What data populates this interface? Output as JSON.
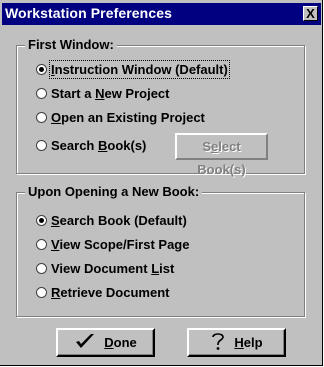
{
  "window": {
    "title": "Workstation Preferences",
    "close_glyph": "X"
  },
  "first_window": {
    "label": "First Window:",
    "options": [
      {
        "pre": "",
        "key": "I",
        "post": "nstruction Window (Default)",
        "selected": true
      },
      {
        "pre": "Start a ",
        "key": "N",
        "post": "ew Project",
        "selected": false
      },
      {
        "pre": "",
        "key": "O",
        "post": "pen an Existing Project",
        "selected": false
      },
      {
        "pre": "Search ",
        "key": "B",
        "post": "ook(s)",
        "selected": false
      }
    ],
    "select_books": {
      "pre": "S",
      "key": "e",
      "post": "lect Book(s)",
      "enabled": false
    }
  },
  "opening_book": {
    "label": "Upon Opening a New Book:",
    "options": [
      {
        "pre": "",
        "key": "S",
        "post": "earch Book (Default)",
        "selected": true
      },
      {
        "pre": "",
        "key": "V",
        "post": "iew Scope/First Page",
        "selected": false
      },
      {
        "pre": "View Document ",
        "key": "L",
        "post": "ist",
        "selected": false
      },
      {
        "pre": "",
        "key": "R",
        "post": "etrieve Document",
        "selected": false
      }
    ]
  },
  "buttons": {
    "done": {
      "key": "D",
      "post": "one",
      "icon": "checkmark-icon"
    },
    "help": {
      "key": "H",
      "post": "elp",
      "icon": "question-mark-icon"
    }
  }
}
